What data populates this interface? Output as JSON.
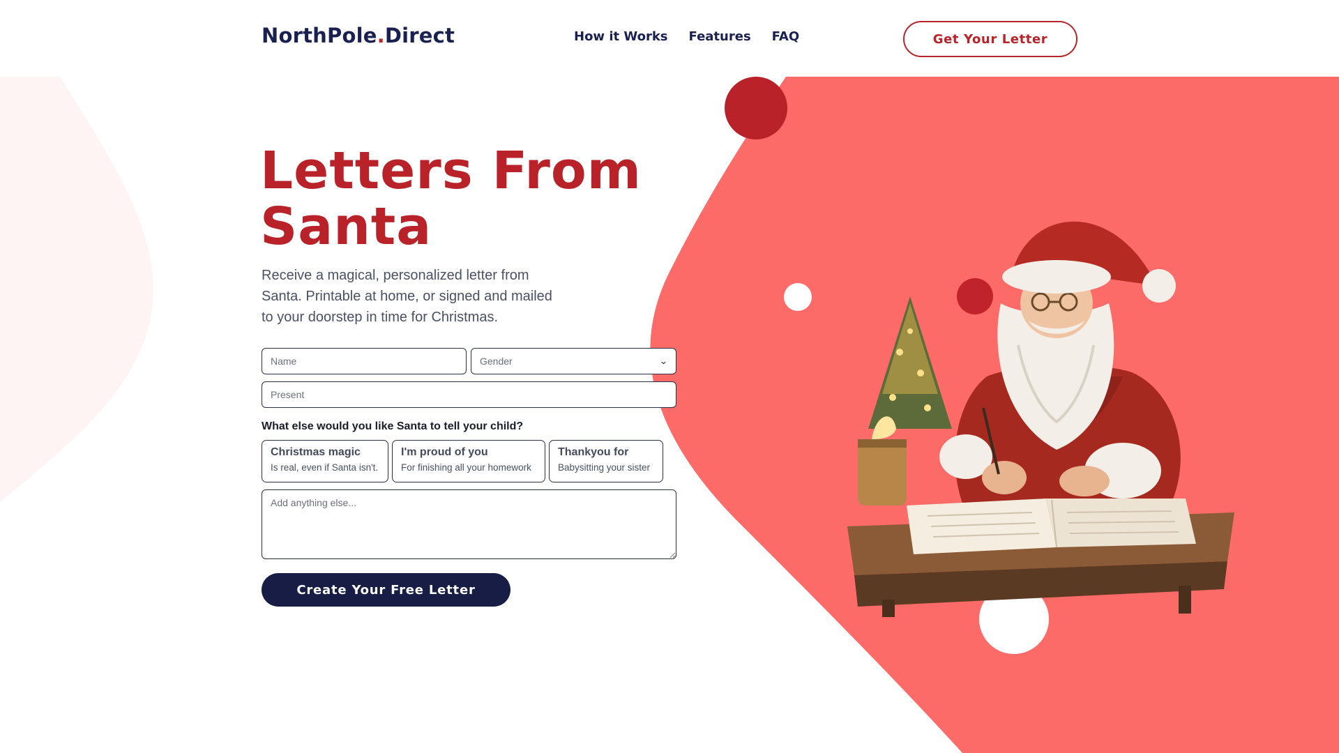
{
  "brand": {
    "name_part1": "NorthPole",
    "dot": ".",
    "name_part2": "Direct"
  },
  "nav": {
    "items": [
      "How it Works",
      "Features",
      "FAQ"
    ],
    "cta_label": "Get Your Letter"
  },
  "hero": {
    "title": "Letters From Santa",
    "subtitle": "Receive a magical, personalized letter from Santa. Printable at home, or signed and mailed to your doorstep in time for Christmas."
  },
  "form": {
    "name_placeholder": "Name",
    "gender_selected": "Gender",
    "present_placeholder": "Present",
    "question": "What else would you like Santa to tell your child?",
    "options": [
      {
        "title": "Christmas magic",
        "subtitle": "Is real, even if Santa isn't."
      },
      {
        "title": "I'm proud of you",
        "subtitle": "For finishing all your homework"
      },
      {
        "title": "Thankyou for",
        "subtitle": "Babysitting your sister"
      }
    ],
    "notes_placeholder": "Add anything else...",
    "submit_label": "Create Your Free Letter"
  },
  "colors": {
    "brand_red": "#b82228",
    "coral_background": "#fd6b69",
    "navy": "#171d45"
  },
  "illustration": "santa-writing-letter-image"
}
